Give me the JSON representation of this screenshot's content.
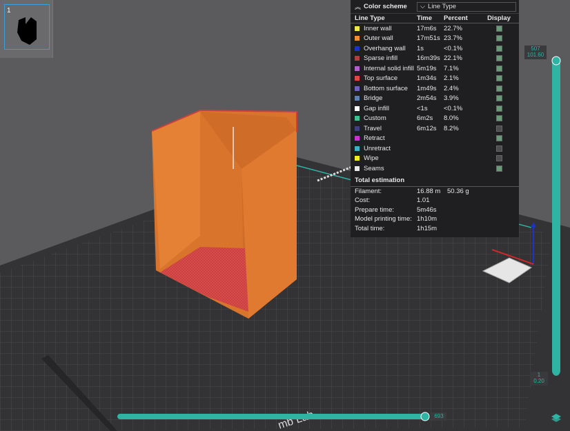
{
  "thumbnail": {
    "plate_number": "1"
  },
  "legend": {
    "title": "Color scheme",
    "selector": "Line Type",
    "headers": {
      "line_type": "Line Type",
      "time": "Time",
      "percent": "Percent",
      "display": "Display"
    },
    "rows": [
      {
        "name": "Inner wall",
        "color": "#f0e84a",
        "time": "17m6s",
        "percent": "22.7%",
        "display": true
      },
      {
        "name": "Outer wall",
        "color": "#f08f30",
        "time": "17m51s",
        "percent": "23.7%",
        "display": true
      },
      {
        "name": "Overhang wall",
        "color": "#1f32c8",
        "time": "1s",
        "percent": "<0.1%",
        "display": true
      },
      {
        "name": "Sparse infill",
        "color": "#b04040",
        "time": "16m39s",
        "percent": "22.1%",
        "display": true
      },
      {
        "name": "Internal solid infill",
        "color": "#b060c8",
        "time": "5m19s",
        "percent": "7.1%",
        "display": true
      },
      {
        "name": "Top surface",
        "color": "#e04848",
        "time": "1m34s",
        "percent": "2.1%",
        "display": true
      },
      {
        "name": "Bottom surface",
        "color": "#7060c0",
        "time": "1m49s",
        "percent": "2.4%",
        "display": true
      },
      {
        "name": "Bridge",
        "color": "#6080b0",
        "time": "2m54s",
        "percent": "3.9%",
        "display": true
      },
      {
        "name": "Gap infill",
        "color": "#ffffff",
        "time": "<1s",
        "percent": "<0.1%",
        "display": true
      },
      {
        "name": "Custom",
        "color": "#40c090",
        "time": "6m2s",
        "percent": "8.0%",
        "display": true
      },
      {
        "name": "Travel",
        "color": "#404080",
        "time": "6m12s",
        "percent": "8.2%",
        "display": false
      },
      {
        "name": "Retract",
        "color": "#d030d0",
        "time": "",
        "percent": "",
        "display": true
      },
      {
        "name": "Unretract",
        "color": "#40b0c8",
        "time": "",
        "percent": "",
        "display": false
      },
      {
        "name": "Wipe",
        "color": "#f0f020",
        "time": "",
        "percent": "",
        "display": false
      },
      {
        "name": "Seams",
        "color": "#e8e8e8",
        "time": "",
        "percent": "",
        "display": true
      }
    ],
    "total": {
      "title": "Total estimation",
      "filament_label": "Filament:",
      "filament_length": "16.88 m",
      "filament_weight": "50.36 g",
      "cost_label": "Cost:",
      "cost": "1.01",
      "prepare_label": "Prepare time:",
      "prepare": "5m46s",
      "model_label": "Model printing time:",
      "model": "1h10m",
      "total_label": "Total time:",
      "total": "1h15m"
    }
  },
  "vslider": {
    "top_layer": "507",
    "top_height": "101.60",
    "bottom_layer": "1",
    "bottom_height": "0.20"
  },
  "hslider": {
    "value": "693"
  },
  "bed_brand": "mb Lab",
  "colors": {
    "accent": "#2fb3a3",
    "part": "#e07a30",
    "bed": "#2f2f32"
  }
}
